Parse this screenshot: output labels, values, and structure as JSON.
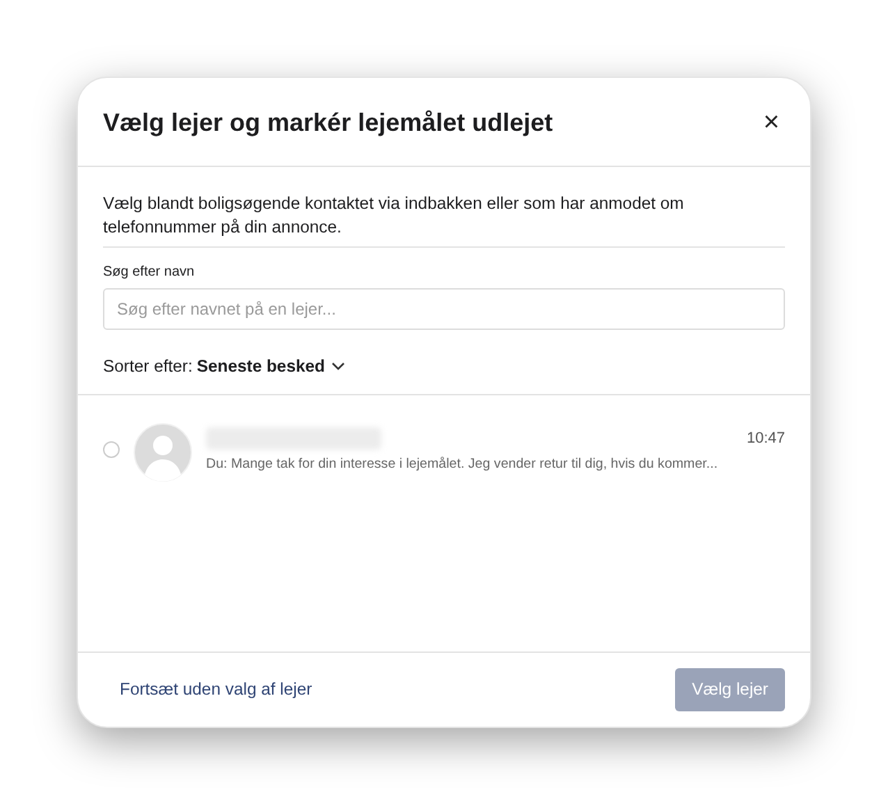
{
  "dialog": {
    "title": "Vælg lejer og markér lejemålet udlejet",
    "close": "×"
  },
  "intro": "Vælg blandt boligsøgende kontaktet via indbakken eller som har anmodet om telefonnummer på din annonce.",
  "search": {
    "label": "Søg efter navn",
    "placeholder": "Søg efter navnet på en lejer..."
  },
  "sort": {
    "label": "Sorter efter:",
    "value": "Seneste besked"
  },
  "tenants": [
    {
      "selected": false,
      "time": "10:47",
      "message": "Du: Mange tak for din interesse i lejemålet. Jeg vender retur til dig, hvis du kommer..."
    }
  ],
  "footer": {
    "skip_link": "Fortsæt uden valg af lejer",
    "confirm": {
      "label": "Vælg lejer",
      "disabled": true
    }
  }
}
